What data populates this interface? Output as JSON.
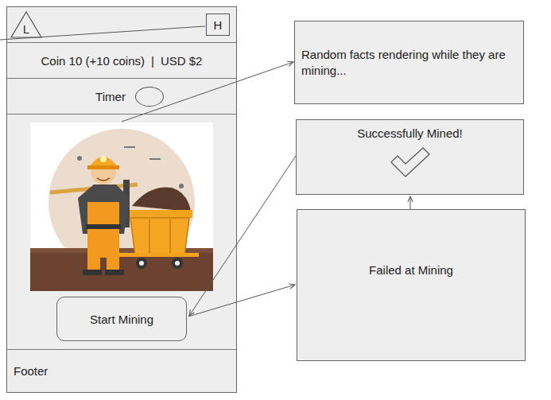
{
  "phone": {
    "header": {
      "left_icon": "L",
      "right_icon": "H"
    },
    "balance": {
      "coins": "Coin 10 (+10 coins)",
      "separator": "|",
      "usd": "USD $2"
    },
    "timer": "Timer",
    "primary_button": "Start Mining",
    "footer": "Footer"
  },
  "notes": [
    {
      "text": "Random facts rendering while they are mining...",
      "kind": "note"
    },
    {
      "text": "Successfully Mined!",
      "kind": "success"
    },
    {
      "text": "Failed at Mining",
      "kind": "status"
    }
  ]
}
